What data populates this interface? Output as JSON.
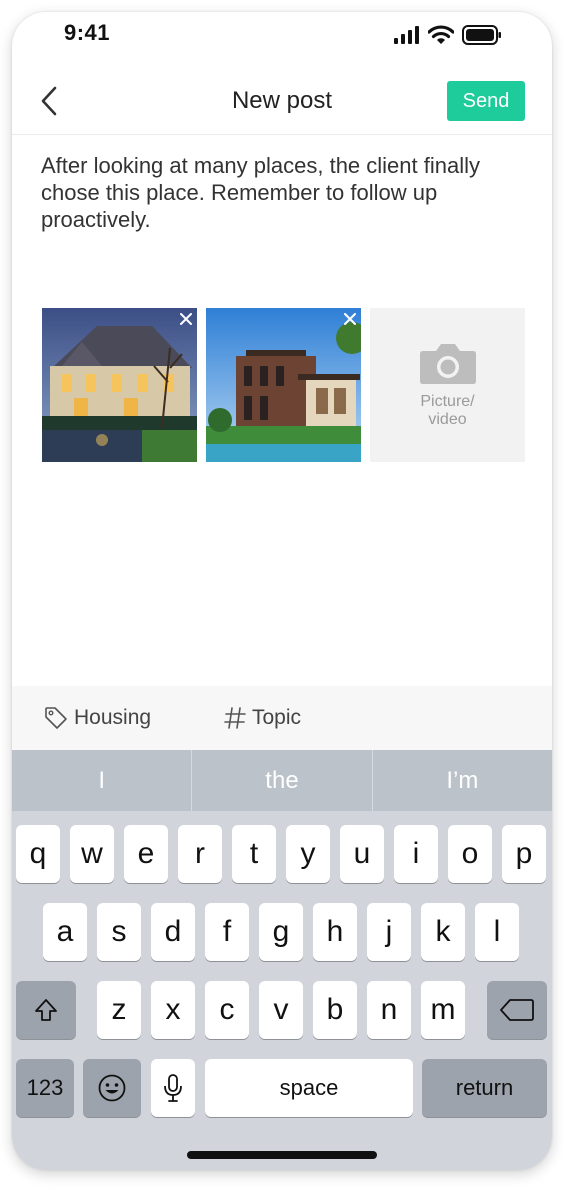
{
  "status_bar": {
    "time": "9:41"
  },
  "nav": {
    "title": "New post",
    "send_label": "Send"
  },
  "post": {
    "text": "After looking at many places, the client finally chose this place. Remember to follow up proactively."
  },
  "media": {
    "add_label_line1": "Picture/",
    "add_label_line2": "video"
  },
  "tags": [
    {
      "icon": "tag-icon",
      "label": "Housing"
    },
    {
      "icon": "hash-icon",
      "label": "Topic"
    }
  ],
  "keyboard": {
    "suggestions": [
      "I",
      "the",
      "I’m"
    ],
    "row1": [
      "q",
      "w",
      "e",
      "r",
      "t",
      "y",
      "u",
      "i",
      "o",
      "p"
    ],
    "row2": [
      "a",
      "s",
      "d",
      "f",
      "g",
      "h",
      "j",
      "k",
      "l"
    ],
    "row3": [
      "z",
      "x",
      "c",
      "v",
      "b",
      "n",
      "m"
    ],
    "numbers_label": "123",
    "space_label": "space",
    "return_label": "return"
  },
  "colors": {
    "accent": "#1ecb9a",
    "keyboard_bg": "#d1d4da",
    "suggestion_bg": "#bcc2ca"
  }
}
